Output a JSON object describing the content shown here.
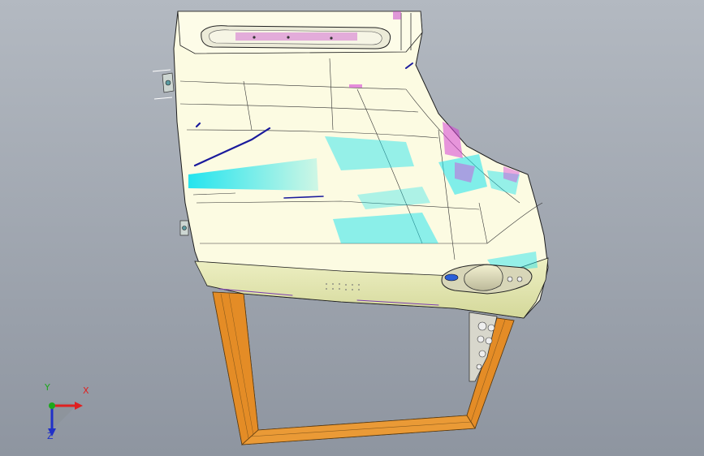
{
  "viewport": {
    "background_top": "#b3b9c1",
    "background_bottom": "#8e95a0"
  },
  "model": {
    "name": "door-panel",
    "panel_color": "#fcfbe0",
    "panel_lower_color": "#e6e9b4",
    "frame_color": "#e8962e",
    "highlight_cyan": "#16e6f0",
    "highlight_magenta": "#d642d6",
    "edge_color": "#1e1e1e",
    "blue_stroke": "#1a1a9c"
  },
  "triad": {
    "x_label": "X",
    "y_label": "Y",
    "z_label": "Z",
    "x_color": "#e02020",
    "y_color": "#1ca81c",
    "z_color": "#2030c8"
  }
}
